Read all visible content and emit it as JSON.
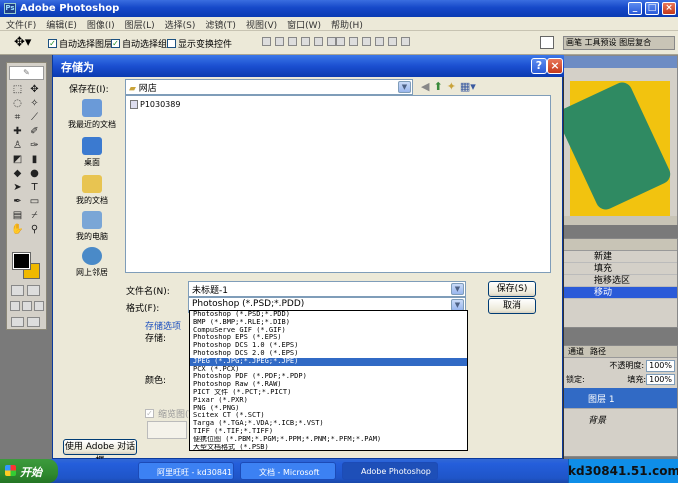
{
  "photoshop": {
    "title": "Adobe Photoshop",
    "menu": [
      "文件(F)",
      "编辑(E)",
      "图像(I)",
      "图层(L)",
      "选择(S)",
      "滤镜(T)",
      "视图(V)",
      "窗口(W)",
      "帮助(H)"
    ],
    "options": {
      "auto_select_layer": "自动选择图层",
      "auto_select_group": "自动选择组",
      "show_transform": "显示变换控件"
    },
    "palette_tabs": "画笔 工具预设 图层复合",
    "history": [
      "新建",
      "填充",
      "拖移选区",
      "移动"
    ],
    "layers": {
      "opacity_label": "不透明度:",
      "opacity": "100%",
      "fill_label": "填充:",
      "fill": "100%",
      "lock_label": "锁定:",
      "layer_name": "图层 1",
      "bg_name": "背景",
      "tab_channels": "通道",
      "tab_paths": "路径"
    }
  },
  "dialog": {
    "title": "存储为",
    "save_in_label": "保存在(I):",
    "save_in_value": "网店",
    "places": [
      "我最近的文档",
      "桌面",
      "我的文档",
      "我的电脑",
      "网上邻居"
    ],
    "files": [
      "P1030389"
    ],
    "filename_label": "文件名(N):",
    "filename_value": "未标题-1",
    "format_label": "格式(F):",
    "format_value": "Photoshop (*.PSD;*.PDD)",
    "save_button": "保存(S)",
    "cancel_button": "取消",
    "options_heading": "存储选项",
    "store_label": "存储:",
    "color_label": "颜色:",
    "thumbnail_label": "缩览图(T)",
    "adobe_dialog_button": "使用 Adobe 对话框",
    "format_options": [
      "Photoshop (*.PSD;*.PDD)",
      "BMP (*.BMP;*.RLE;*.DIB)",
      "CompuServe GIF (*.GIF)",
      "Photoshop EPS (*.EPS)",
      "Photoshop DCS 1.0 (*.EPS)",
      "Photoshop DCS 2.0 (*.EPS)",
      "JPEG (*.JPG;*.JPEG;*.JPE)",
      "PCX (*.PCX)",
      "Photoshop PDF (*.PDF;*.PDP)",
      "Photoshop Raw (*.RAW)",
      "PICT 文件 (*.PCT;*.PICT)",
      "Pixar (*.PXR)",
      "PNG (*.PNG)",
      "Scitex CT (*.SCT)",
      "Targa (*.TGA;*.VDA;*.ICB;*.VST)",
      "TIFF (*.TIF;*.TIFF)",
      "便携位图 (*.PBM;*.PGM;*.PPM;*.PNM;*.PFM;*.PAM)",
      "大型文档格式 (*.PSB)"
    ],
    "selected_option_index": 6
  },
  "taskbar": {
    "start": "开始",
    "tasks": [
      "阿里旺旺 - kd30841",
      "文档 - Microsoft",
      "Adobe Photoshop"
    ],
    "watermark": "kd30841.51.com"
  },
  "colors": {
    "accent": "#316ac5",
    "foreground_swatch": "#000000",
    "background_swatch": "#f0b800"
  }
}
